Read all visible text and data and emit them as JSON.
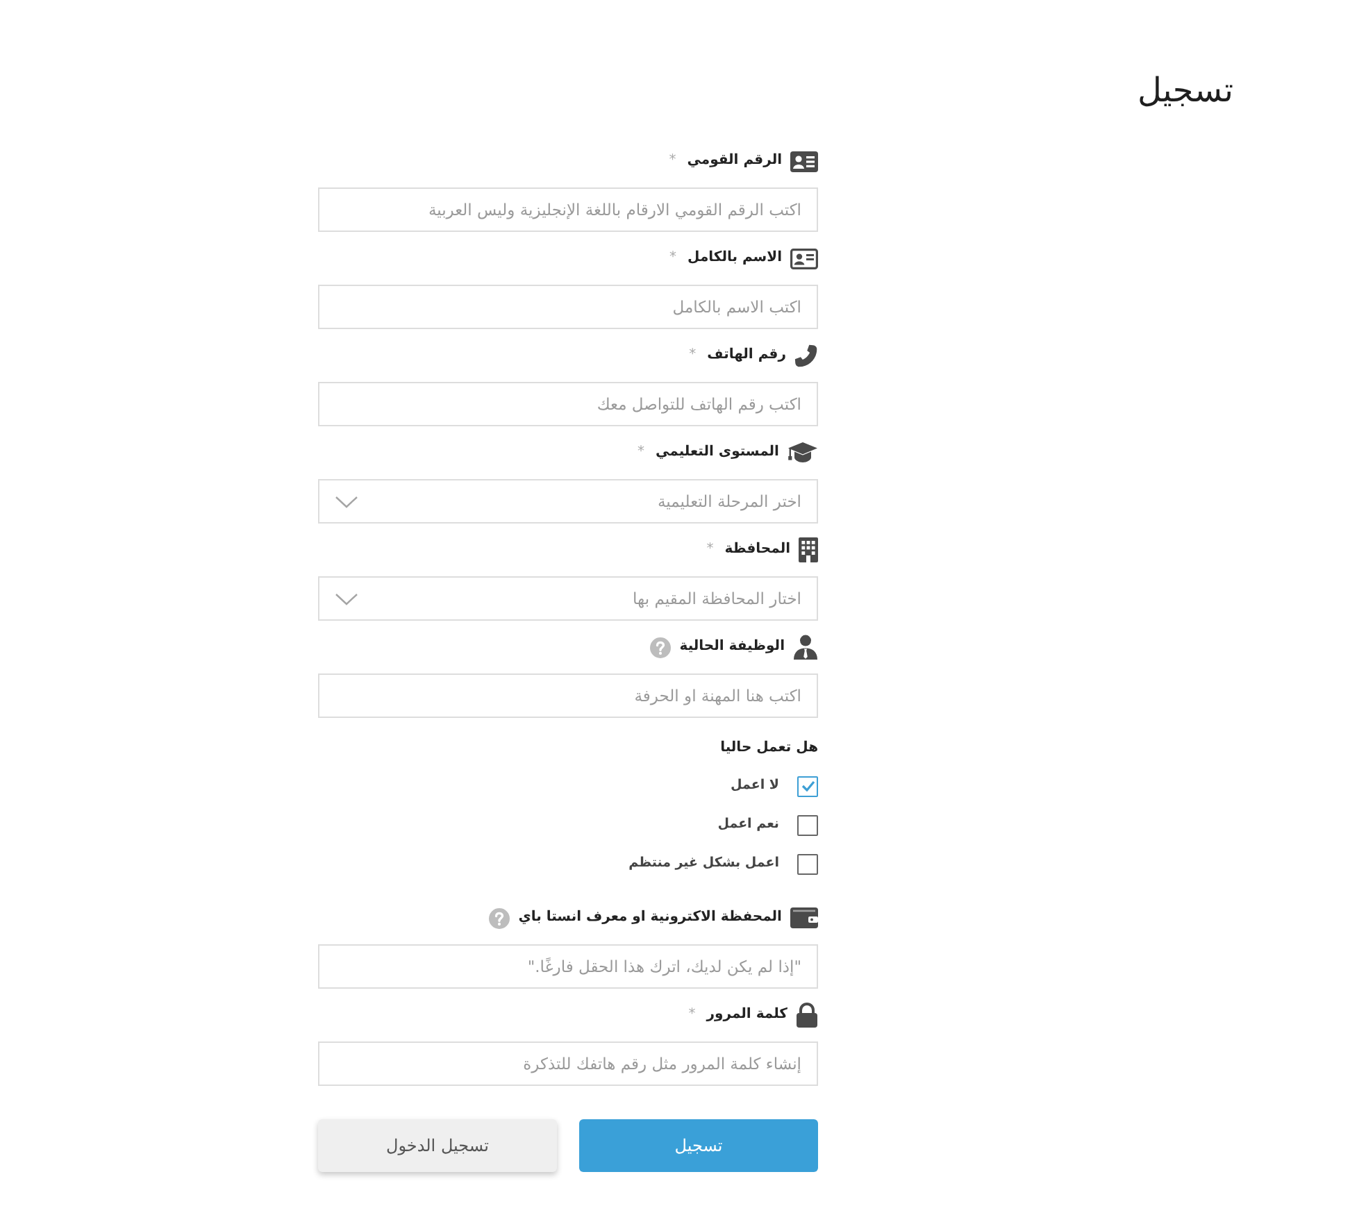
{
  "page": {
    "title": "تسجيل"
  },
  "fields": [
    {
      "kind": "input",
      "label": "الرقم القومي",
      "required_mark": "*",
      "help": false,
      "placeholder": "اكتب الرقم القومي الارقام باللغة الإنجليزية وليس العربية"
    },
    {
      "kind": "input",
      "label": "الاسم بالكامل",
      "required_mark": "*",
      "help": false,
      "placeholder": "اكتب الاسم بالكامل"
    },
    {
      "kind": "input",
      "label": "رقم الهاتف",
      "required_mark": "*",
      "help": false,
      "placeholder": "اكتب رقم الهاتف للتواصل معك"
    },
    {
      "kind": "select",
      "label": "المستوى التعليمي",
      "required_mark": "*",
      "help": false,
      "placeholder": "اختر المرحلة التعليمية"
    },
    {
      "kind": "select",
      "label": "المحافظة",
      "required_mark": "*",
      "help": false,
      "placeholder": "اختار المحافظة المقيم بها"
    },
    {
      "kind": "input",
      "label": "الوظيفة الحالية",
      "help": true,
      "placeholder": "اكتب هنا المهنة او الحرفة"
    },
    {
      "kind": "checkboxes",
      "label": "هل تعمل حاليا",
      "options": [
        {
          "label": "لا اعمل",
          "checked": true
        },
        {
          "label": "نعم اعمل",
          "checked": false
        },
        {
          "label": "اعمل بشكل غير منتظم",
          "checked": false
        }
      ]
    },
    {
      "kind": "input",
      "label": "المحفظة الاكترونية او معرف انستا باي",
      "help": true,
      "placeholder": "\"إذا لم يكن لديك، اترك هذا الحقل فارغًا.\""
    },
    {
      "kind": "password",
      "label": "كلمة المرور",
      "required_mark": "*",
      "help": false,
      "placeholder": "إنشاء كلمة المرور مثل رقم هاتفك للتذكرة"
    }
  ],
  "buttons": [
    {
      "kind": "primary",
      "label": "تسجيل"
    },
    {
      "kind": "secondary",
      "label": "تسجيل الدخول"
    }
  ]
}
